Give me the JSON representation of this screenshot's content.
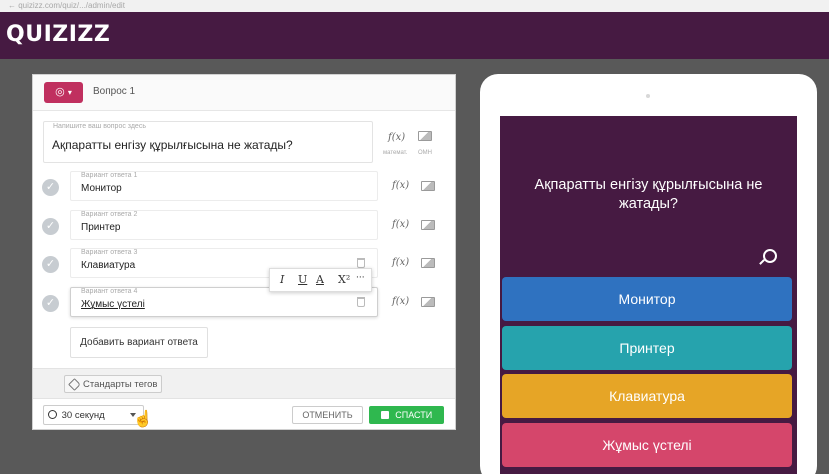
{
  "browser": {
    "url_text": "←  quizizz.com/quiz/.../admin/edit"
  },
  "header": {
    "logo": "QUIZIZZ"
  },
  "editor": {
    "question_number": "Вопрос 1",
    "question_label": "Напишите ваш вопрос здесь",
    "question_text": "Ақпаратты енгізу құрылғысына не жатады?",
    "fx_label": "f(x)",
    "math_label": "математ.",
    "media_label": "ОМН",
    "answers": [
      {
        "label": "Вариант ответа 1",
        "text": "Монитор"
      },
      {
        "label": "Вариант ответа 2",
        "text": "Принтер"
      },
      {
        "label": "Вариант ответа 3",
        "text": "Клавиатура"
      },
      {
        "label": "Вариант ответа 4",
        "text": "Жұмыс үстелі"
      }
    ],
    "format_toolbar": {
      "italic": "I",
      "underline": "U",
      "text_color": "A",
      "superscript": "X²",
      "more": "···"
    },
    "add_answer": "Добавить вариант ответа",
    "tags_button": "Стандарты тегов",
    "time_select": "30 секунд",
    "cancel": "ОТМЕНИТЬ",
    "save": "СПАСТИ"
  },
  "preview": {
    "question": "Ақпаратты енгізу құрылғысына не жатады?",
    "options": [
      {
        "text": "Монитор",
        "color": "#2f72c0"
      },
      {
        "text": "Принтер",
        "color": "#26a3ad"
      },
      {
        "text": "Клавиатура",
        "color": "#e6a526"
      },
      {
        "text": "Жұмыс үстелі",
        "color": "#d5466b"
      }
    ]
  },
  "colors": {
    "header": "#461a42",
    "type_button": "#c0305f",
    "save_button": "#2fb84f"
  }
}
